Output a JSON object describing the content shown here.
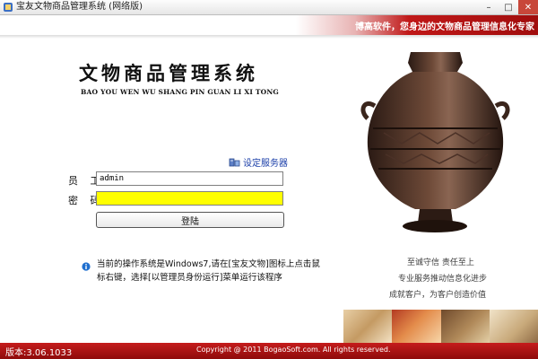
{
  "window": {
    "title": "宝友文物商品管理系统 (网络版)",
    "icon": "app-icon",
    "controls": [
      "minimize-icon",
      "maximize-icon",
      "close-icon"
    ]
  },
  "header": {
    "slogan": "博高软件，您身边的文物商品管理信息化专家"
  },
  "branding": {
    "title": "文物商品管理系统",
    "subtitle": "BAO  YOU WEN WU SHANG PIN GUAN LI XI TONG"
  },
  "login": {
    "server_link": "设定服务器",
    "user_label": "员 工:",
    "user_value": "admin",
    "password_label": "密 码:",
    "password_value": "",
    "login_button": "登陆"
  },
  "notice": {
    "text": "当前的操作系统是Windows7,请在[宝友文物]图标上点击鼠标右键，选择[以管理员身份运行]菜单运行该程序"
  },
  "mottos": [
    "至诚守信 责任至上",
    "专业服务推动信息化进步",
    "成就客户，为客户创造价值"
  ],
  "footer": {
    "version": "版本:3.06.1033",
    "copyright": "Copyright @ 2011 BogaoSoft.com. All rights reserved."
  },
  "colors": {
    "accent_red": "#b01212",
    "link_blue": "#1a3ea8",
    "password_bg": "#ffff00"
  }
}
